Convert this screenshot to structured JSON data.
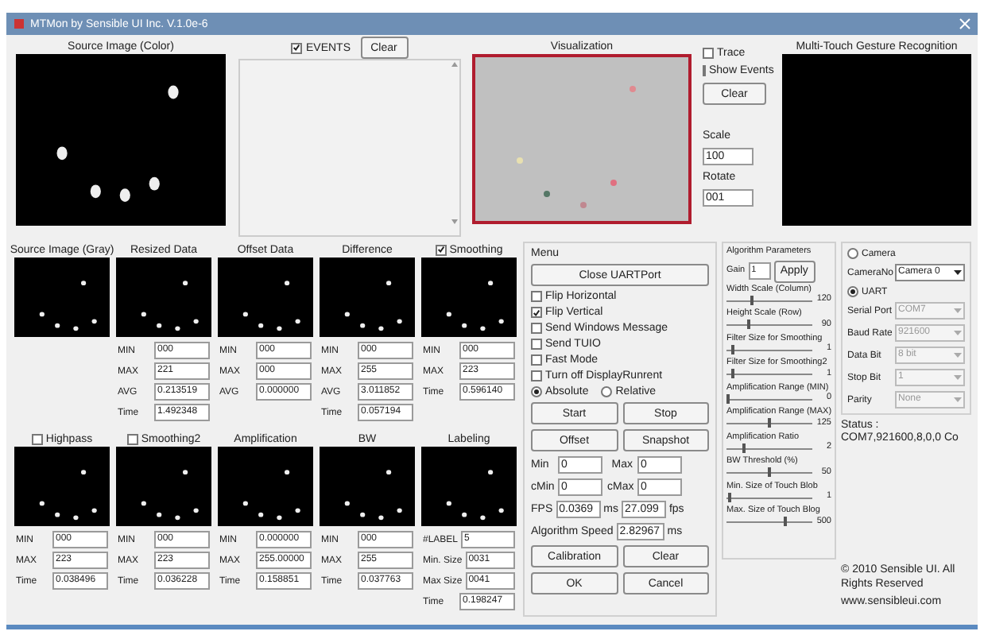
{
  "window": {
    "title": "MTMon by Sensible UI Inc. V.1.0e-6"
  },
  "source_color": {
    "title": "Source Image (Color)"
  },
  "events": {
    "label": "EVENTS",
    "checked": true,
    "clear": "Clear"
  },
  "visualization": {
    "title": "Visualization"
  },
  "view_options": {
    "checks": [
      {
        "label": "Trace",
        "checked": false
      },
      {
        "label": "Show Events",
        "checked": false
      }
    ],
    "clear": "Clear",
    "scale_label": "Scale",
    "scale": "100",
    "rotate_label": "Rotate",
    "rotate": "001"
  },
  "gesture": {
    "title": "Multi-Touch Gesture Recognition"
  },
  "panels_top": [
    {
      "kind": "text",
      "title": "Source Image (Gray)"
    },
    {
      "kind": "text",
      "title": "Resized Data",
      "stats": [
        {
          "label": "MIN",
          "value": "000"
        },
        {
          "label": "MAX",
          "value": "221"
        },
        {
          "label": "AVG",
          "value": "0.213519"
        },
        {
          "label": "Time",
          "value": "1.492348"
        }
      ]
    },
    {
      "kind": "text",
      "title": "Offset Data",
      "stats": [
        {
          "label": "MIN",
          "value": "000"
        },
        {
          "label": "MAX",
          "value": "000"
        },
        {
          "label": "AVG",
          "value": "0.000000"
        }
      ]
    },
    {
      "kind": "text",
      "title": "Difference",
      "stats": [
        {
          "label": "MIN",
          "value": "000"
        },
        {
          "label": "MAX",
          "value": "255"
        },
        {
          "label": "AVG",
          "value": "3.011852"
        },
        {
          "label": "Time",
          "value": "0.057194"
        }
      ]
    },
    {
      "kind": "checkbox",
      "title": "Smoothing",
      "checked": true,
      "stats": [
        {
          "label": "MIN",
          "value": "000"
        },
        {
          "label": "MAX",
          "value": "223"
        },
        {
          "label": "Time",
          "value": "0.596140"
        }
      ]
    }
  ],
  "panels_bottom": [
    {
      "kind": "checkbox",
      "title": "Highpass",
      "checked": false,
      "stats": [
        {
          "label": "MIN",
          "value": "000"
        },
        {
          "label": "MAX",
          "value": "223"
        },
        {
          "label": "Time",
          "value": "0.038496"
        }
      ]
    },
    {
      "kind": "checkbox",
      "title": "Smoothing2",
      "checked": false,
      "stats": [
        {
          "label": "MIN",
          "value": "000"
        },
        {
          "label": "MAX",
          "value": "223"
        },
        {
          "label": "Time",
          "value": "0.036228"
        }
      ]
    },
    {
      "kind": "text",
      "title": "Amplification",
      "stats": [
        {
          "label": "MIN",
          "value": "0.000000"
        },
        {
          "label": "MAX",
          "value": "255.00000"
        },
        {
          "label": "Time",
          "value": "0.158851"
        }
      ]
    },
    {
      "kind": "text",
      "title": "BW",
      "stats": [
        {
          "label": "MIN",
          "value": "000"
        },
        {
          "label": "MAX",
          "value": "255"
        },
        {
          "label": "Time",
          "value": "0.037763"
        }
      ]
    },
    {
      "kind": "text",
      "title": "Labeling",
      "stats": [
        {
          "label": "#LABEL",
          "value": "5"
        },
        {
          "label": "Min. Size",
          "value": "0031"
        },
        {
          "label": "Max Size",
          "value": "0041"
        },
        {
          "label": "Time",
          "value": "0.198247"
        }
      ]
    }
  ],
  "menu": {
    "title": "Menu",
    "close_port": "Close UARTPort",
    "options": [
      {
        "label": "Flip Horizontal",
        "checked": false
      },
      {
        "label": "Flip Vertical",
        "checked": true
      },
      {
        "label": "Send Windows Message",
        "checked": false
      },
      {
        "label": "Send TUIO",
        "checked": false
      },
      {
        "label": "Fast Mode",
        "checked": false
      },
      {
        "label": "Turn off DisplayRunrent",
        "checked": false
      }
    ],
    "modes": [
      {
        "label": "Absolute",
        "selected": true
      },
      {
        "label": "Relative",
        "selected": false
      }
    ],
    "buttons_1": [
      "Start",
      "Stop",
      "Offset",
      "Snapshot"
    ],
    "min_label": "Min",
    "min": "0",
    "max_label": "Max",
    "max": "0",
    "cmin_label": "cMin",
    "cmin": "0",
    "cmax_label": "cMax",
    "cmax": "0",
    "fps_label": "FPS",
    "fps_ms": "0.0369",
    "fps_ms_unit": "ms",
    "fps": "27.099",
    "fps_unit": "fps",
    "speed_label": "Algorithm Speed",
    "speed": "2.82967",
    "speed_unit": "ms",
    "buttons_2": [
      "Calibration",
      "Clear",
      "OK",
      "Cancel"
    ]
  },
  "algorithm": {
    "title": "Algorithm Parameters",
    "gain_label": "Gain",
    "gain": "1",
    "apply": "Apply",
    "params": [
      {
        "label": "Width Scale (Column)",
        "level": 0.3,
        "reading": "120"
      },
      {
        "label": "Height Scale (Row)",
        "level": 0.25,
        "reading": "90"
      },
      {
        "label": "Filter Size for Smoothing",
        "level": 0.05,
        "reading": "1"
      },
      {
        "label": "Filter Size for Smoothing2",
        "level": 0.05,
        "reading": "1"
      },
      {
        "label": "Amplification Range (MIN)",
        "level": 0.0,
        "reading": "0"
      },
      {
        "label": "Amplification Range (MAX)",
        "level": 0.5,
        "reading": "125"
      },
      {
        "label": "Amplification Ratio",
        "level": 0.2,
        "reading": "2"
      },
      {
        "label": "BW Threshold (%)",
        "level": 0.5,
        "reading": "50"
      },
      {
        "label": "Min. Size of Touch Blob",
        "level": 0.02,
        "reading": "1"
      },
      {
        "label": "Max. Size of Touch Blog",
        "level": 0.7,
        "reading": "500"
      }
    ]
  },
  "source": {
    "camera": {
      "label": "Camera",
      "selected": false
    },
    "camera_no_label": "CameraNo",
    "camera_no": "Camera 0",
    "uart": {
      "label": "UART",
      "selected": true
    },
    "settings": [
      {
        "label": "Serial Port",
        "value": "COM7"
      },
      {
        "label": "Baud Rate",
        "value": "921600"
      },
      {
        "label": "Data Bit",
        "value": "8 bit"
      },
      {
        "label": "Stop Bit",
        "value": "1"
      },
      {
        "label": "Parity",
        "value": "None"
      }
    ]
  },
  "status": "Status : COM7,921600,8,0,0 Co",
  "copyright": "© 2010 Sensible UI. All Rights Reserved",
  "website": "www.sensibleui.com"
}
